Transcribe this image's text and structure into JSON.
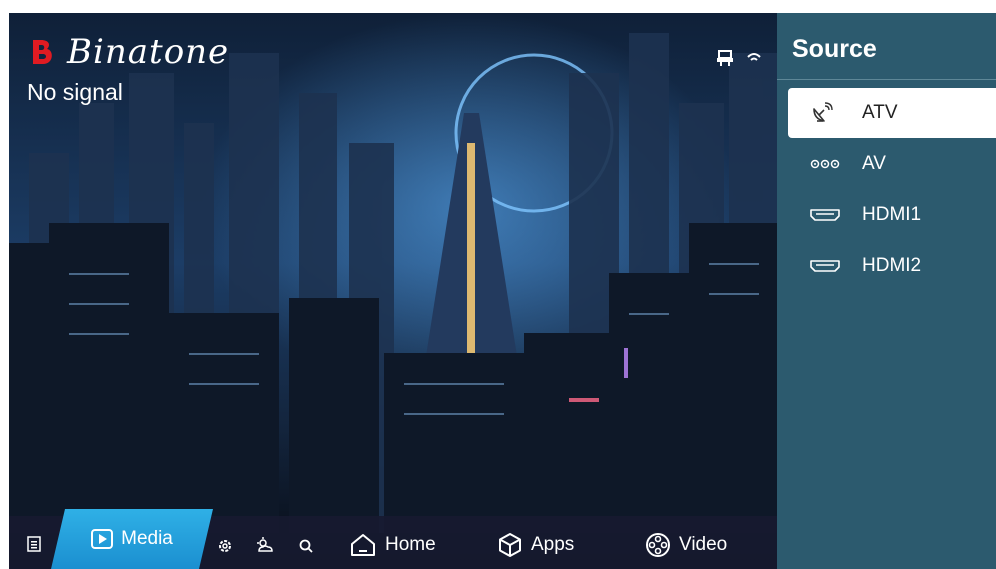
{
  "brand": {
    "name": "Binatone",
    "color": "#e01b22"
  },
  "status": {
    "signal": "No signal"
  },
  "bottom_bar": {
    "media": "Media",
    "home": "Home",
    "apps": "Apps",
    "video": "Video"
  },
  "source_panel": {
    "title": "Source",
    "items": [
      {
        "label": "ATV",
        "icon": "satellite-dish-icon",
        "selected": true
      },
      {
        "label": "AV",
        "icon": "av-ports-icon",
        "selected": false
      },
      {
        "label": "HDMI1",
        "icon": "hdmi-icon",
        "selected": false
      },
      {
        "label": "HDMI2",
        "icon": "hdmi-icon",
        "selected": false
      }
    ]
  },
  "colors": {
    "panel_bg": "#2c5a6e",
    "accent_tab": "#1b8fd0",
    "bar_bg": "#171a30"
  }
}
